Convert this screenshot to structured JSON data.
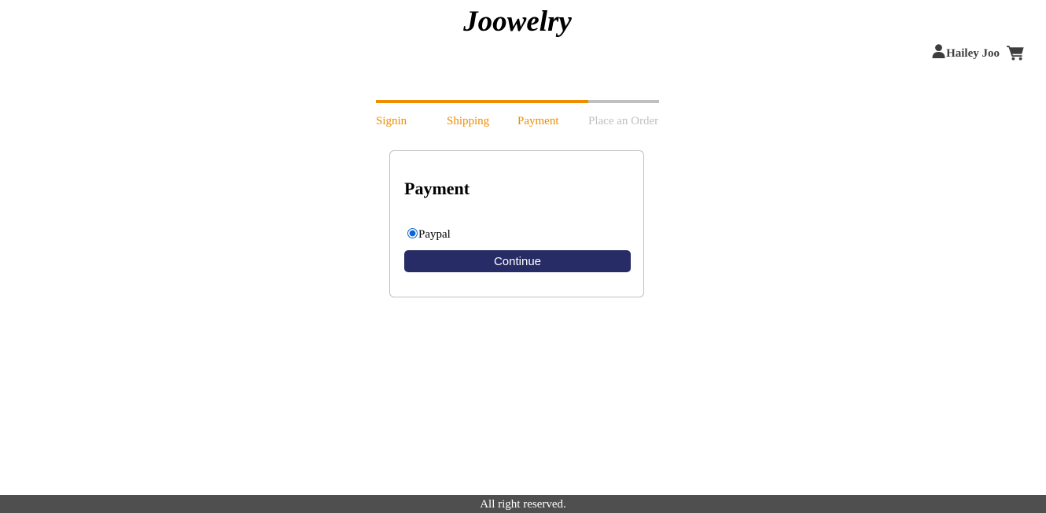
{
  "header": {
    "brand": "Joowelry",
    "user_name": "Hailey Joo",
    "user_icon": "user-icon",
    "cart_icon": "cart-icon"
  },
  "checkout_steps": [
    {
      "label": "Signin",
      "active": true
    },
    {
      "label": "Shipping",
      "active": true
    },
    {
      "label": "Payment",
      "active": true
    },
    {
      "label": "Place an Order",
      "active": false
    }
  ],
  "payment": {
    "title": "Payment",
    "method_label": "Paypal",
    "method_selected": true,
    "continue_label": "Continue"
  },
  "footer": {
    "text": "All right reserved."
  },
  "colors": {
    "accent": "#f08c00",
    "inactive": "#c0c0c0",
    "button": "#272c66",
    "footer": "#4f4f4f"
  }
}
